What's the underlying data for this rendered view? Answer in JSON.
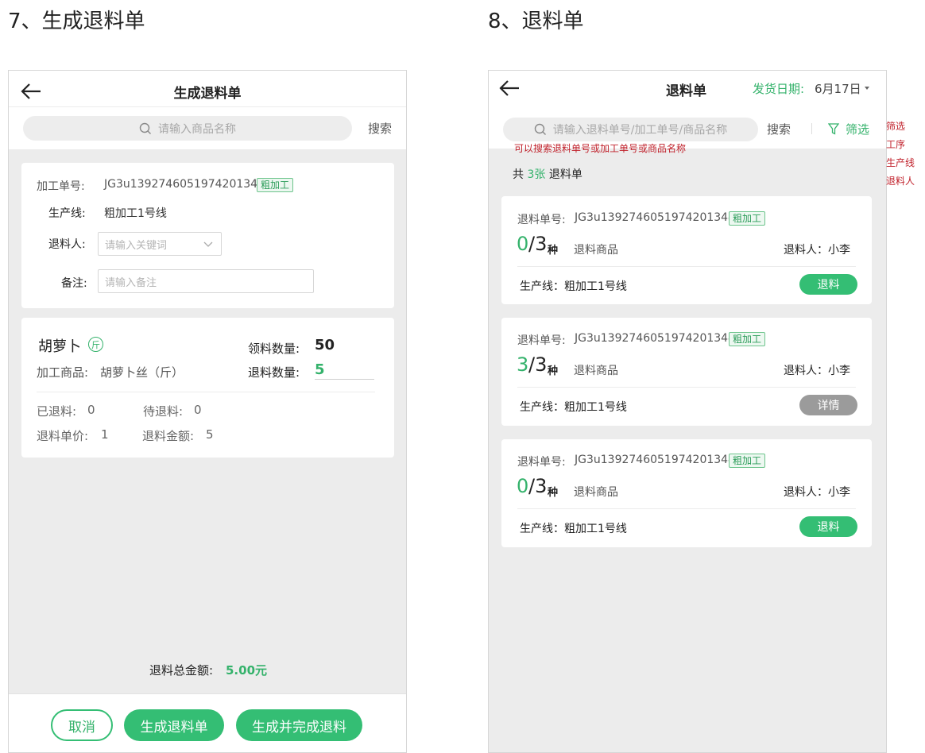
{
  "sections": {
    "left_title": "7、生成退料单",
    "right_title": "8、退料单"
  },
  "left": {
    "title": "生成退料单",
    "search_placeholder": "请输入商品名称",
    "search_btn": "搜索",
    "info": {
      "order_label": "加工单号:",
      "order_value": "JG3u1392746051974201344",
      "order_tag": "粗加工",
      "line_label": "生产线:",
      "line_value": "粗加工1号线",
      "person_label": "退料人:",
      "person_placeholder": "请输入关键词",
      "remark_label": "备注:",
      "remark_placeholder": "请输入备注"
    },
    "product": {
      "name": "胡萝卜",
      "unit_badge": "斤",
      "processed_label": "加工商品:",
      "processed_value": "胡萝卜丝（斤）",
      "receive_label": "领料数量:",
      "receive_value": "50",
      "return_label": "退料数量:",
      "return_value": "5",
      "returned_label": "已退料:",
      "returned_value": "0",
      "pending_label": "待退料:",
      "pending_value": "0",
      "price_label": "退料单价:",
      "price_value": "1",
      "amount_label": "退料金额:",
      "amount_value": "5"
    },
    "total_label": "退料总金额:",
    "total_value": "5.00元",
    "cancel_btn": "取消",
    "generate_btn": "生成退料单",
    "generate_complete_btn": "生成并完成退料"
  },
  "right": {
    "title": "退料单",
    "date_label": "发货日期:",
    "date_value": "6月17日",
    "search_placeholder": "请输入退料单号/加工单号/商品名称",
    "search_btn": "搜索",
    "filter_btn": "筛选",
    "search_note": "可以搜索退料单号或加工单号或商品名称",
    "side_notes": [
      "筛选",
      "工序",
      "生产线",
      "退料人"
    ],
    "count_prefix": "共",
    "count_value": "3张",
    "count_suffix": "退料单",
    "orders": [
      {
        "order_label": "退料单号:",
        "order_value": "JG3u1392746051974201344",
        "tag": "粗加工",
        "done": "0",
        "total": "/3",
        "unit": "种",
        "goods_label": "退料商品",
        "person": "退料人：小李",
        "line": "生产线：粗加工1号线",
        "action": "退料",
        "action_color": "#34be74"
      },
      {
        "order_label": "退料单号:",
        "order_value": "JG3u1392746051974201344",
        "tag": "粗加工",
        "done": "3",
        "total": "/3",
        "unit": "种",
        "goods_label": "退料商品",
        "person": "退料人：小李",
        "line": "生产线：粗加工1号线",
        "action": "详情",
        "action_color": "#9b9b9b"
      },
      {
        "order_label": "退料单号:",
        "order_value": "JG3u1392746051974201344",
        "tag": "粗加工",
        "done": "0",
        "total": "/3",
        "unit": "种",
        "goods_label": "退料商品",
        "person": "退料人：小李",
        "line": "生产线：粗加工1号线",
        "action": "退料",
        "action_color": "#34be74"
      }
    ]
  },
  "colors": {
    "accent": "#34be74",
    "note": "#c0202a",
    "tag_border": "#6cc48b"
  },
  "icons": [
    "back-arrow-icon",
    "search-icon",
    "chevron-down-icon",
    "filter-icon",
    "caret-down-icon"
  ]
}
